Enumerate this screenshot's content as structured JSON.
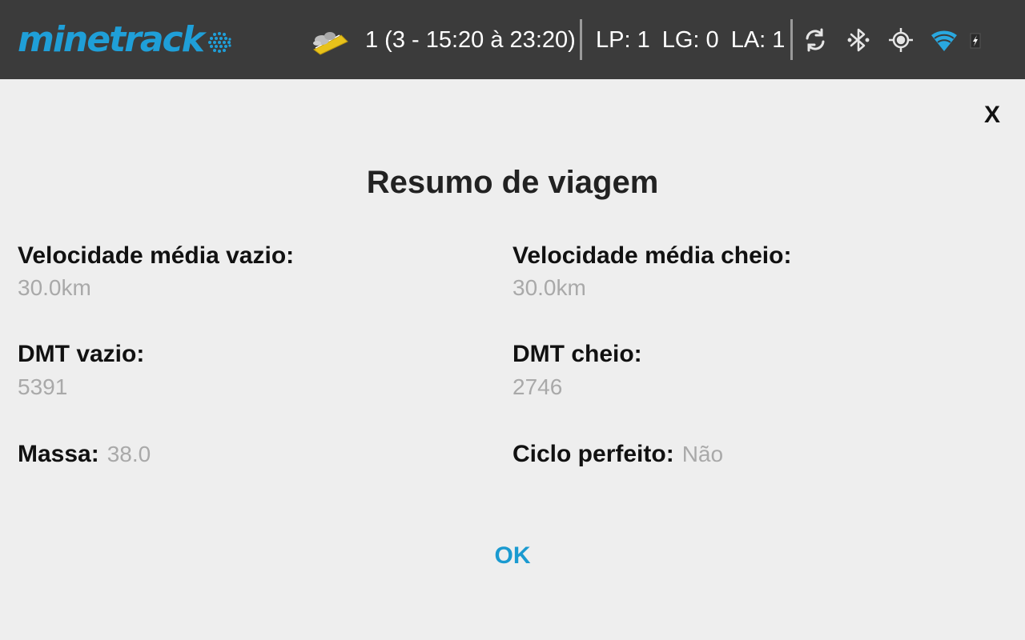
{
  "header": {
    "logo_text": "minetrack",
    "logo_icon": "globe-icon",
    "shift_icon": "dump-truck-icon",
    "shift_text": "1 (3 - 15:20 à 23:20)",
    "counters": [
      {
        "label": "LP:",
        "value": "1"
      },
      {
        "label": "LG:",
        "value": "0"
      },
      {
        "label": "LA:",
        "value": "1"
      }
    ],
    "status_icons": [
      "sync-icon",
      "bluetooth-icon",
      "gps-icon",
      "wifi-icon",
      "battery-charging-icon"
    ],
    "colors": {
      "bar": "#3b3b3b",
      "brand": "#1f9fd8",
      "wifi": "#29a8e0"
    }
  },
  "dialog": {
    "close_label": "X",
    "title": "Resumo de viagem",
    "fields": {
      "avg_speed_empty": {
        "label": "Velocidade média vazio:",
        "value": "30.0km"
      },
      "avg_speed_full": {
        "label": "Velocidade média cheio:",
        "value": "30.0km"
      },
      "dmt_empty": {
        "label": "DMT vazio:",
        "value": "5391"
      },
      "dmt_full": {
        "label": "DMT cheio:",
        "value": "2746"
      },
      "mass": {
        "label": "Massa:",
        "value": "38.0"
      },
      "perfect_cycle": {
        "label": "Ciclo perfeito:",
        "value": "Não"
      }
    },
    "ok_label": "OK",
    "colors": {
      "background": "#eeeeee",
      "label": "#111111",
      "value": "#a9a9a9",
      "action": "#1a9ad0"
    }
  }
}
